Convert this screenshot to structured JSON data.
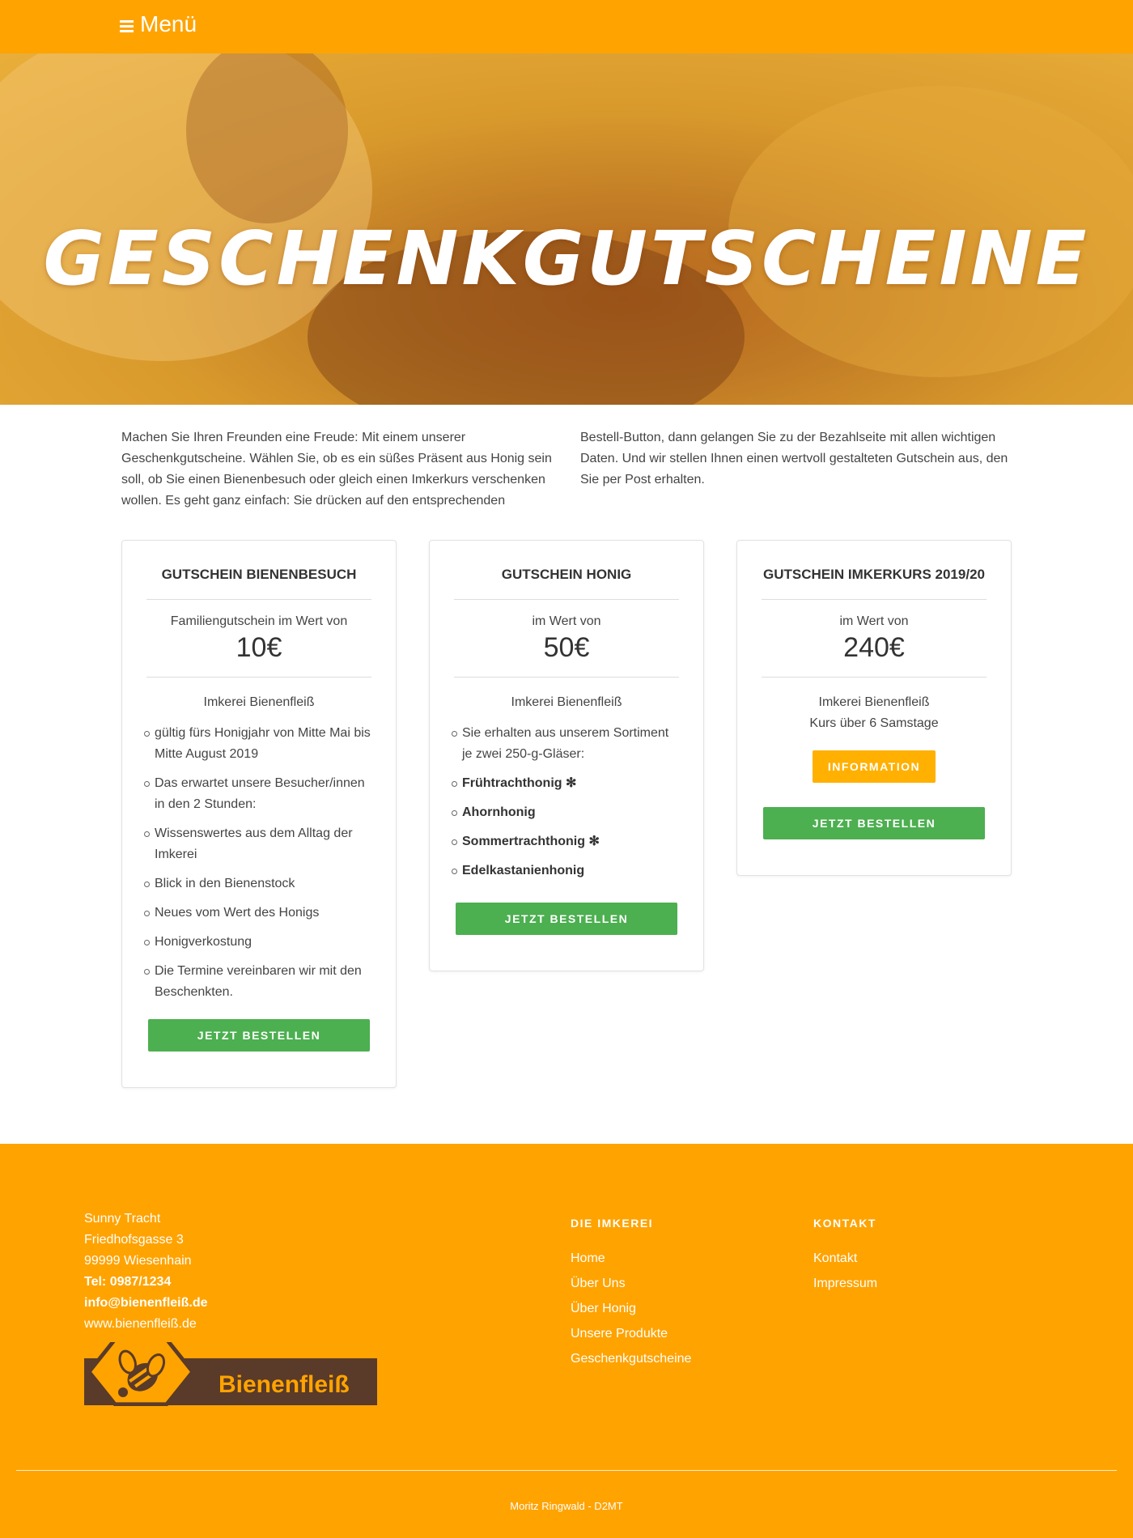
{
  "nav": {
    "menu_label": "Menü",
    "menu_icon": "hamburger-icon"
  },
  "hero": {
    "title": "GESCHENKGUTSCHEINE"
  },
  "intro": {
    "col1": "Machen Sie Ihren Freunden eine Freude: Mit einem unserer Geschenkgutscheine. Wählen Sie, ob es ein süßes Präsent aus Honig sein soll, ob Sie einen Bienenbesuch oder gleich einen Imkerkurs verschenken wollen. Es geht ganz einfach: Sie drücken auf den entsprechenden",
    "col2": "Bestell-Button, dann gelangen Sie zu der Bezahlseite mit allen wichtigen Daten. Und wir stellen Ihnen einen wertvoll gestalteten Gutschein aus, den Sie per Post erhalten."
  },
  "cards": [
    {
      "title": "GUTSCHEIN BIENENBESUCH",
      "price_label": "Familiengutschein im Wert von",
      "price": "10€",
      "org": "Imkerei Bienenfleiß",
      "features": [
        "gültig fürs Honigjahr von Mitte Mai bis Mitte August 2019",
        "Das erwartet unsere Besucher/innen in den 2 Stunden:",
        "Wissenswertes aus dem Alltag der Imkerei",
        "Blick in den Bienenstock",
        "Neues vom Wert des Honigs",
        "Honigverkostung",
        "Die Termine vereinbaren wir mit den Beschenkten."
      ],
      "order_label": "JETZT BESTELLEN"
    },
    {
      "title": "GUTSCHEIN HONIG",
      "price_label": "im Wert von",
      "price": "50€",
      "org": "Imkerei Bienenfleiß",
      "features": [
        "Sie erhalten aus unserem Sortiment je zwei 250-g-Gläser:",
        "Frühtrachthonig ✻",
        "Ahornhonig",
        "Sommertrachthonig ✻",
        "Edelkastanienhonig"
      ],
      "order_label": "JETZT BESTELLEN"
    },
    {
      "title": "GUTSCHEIN IMKERKURS 2019/20",
      "price_label": "im Wert von",
      "price": "240€",
      "org": "Imkerei Bienenfleiß",
      "org2": "Kurs über 6 Samstage",
      "info_label": "INFORMATION",
      "order_label": "JETZT BESTELLEN"
    }
  ],
  "footer": {
    "address": [
      "Sunny Tracht",
      "Friedhofsgasse 3",
      "99999 Wiesenhain"
    ],
    "tel": "Tel: 0987/1234",
    "email": "info@bienenfleiß.de",
    "web": "www.bienenfleiß.de",
    "logo_text": "Bienenfleiß",
    "col1_head": "DIE IMKEREI",
    "col1_links": [
      "Home",
      "Über Uns",
      "Über Honig",
      "Unsere Produkte",
      "Geschenkgutscheine"
    ],
    "col2_head": "KONTAKT",
    "col2_links": [
      "Kontakt",
      "Impressum"
    ],
    "credit": "Moritz Ringwald - D2MT"
  },
  "colors": {
    "brand_orange": "#ffa300",
    "button_green": "#4caf50",
    "button_yellow": "#ffb000",
    "logo_brown": "#5a3a28"
  }
}
